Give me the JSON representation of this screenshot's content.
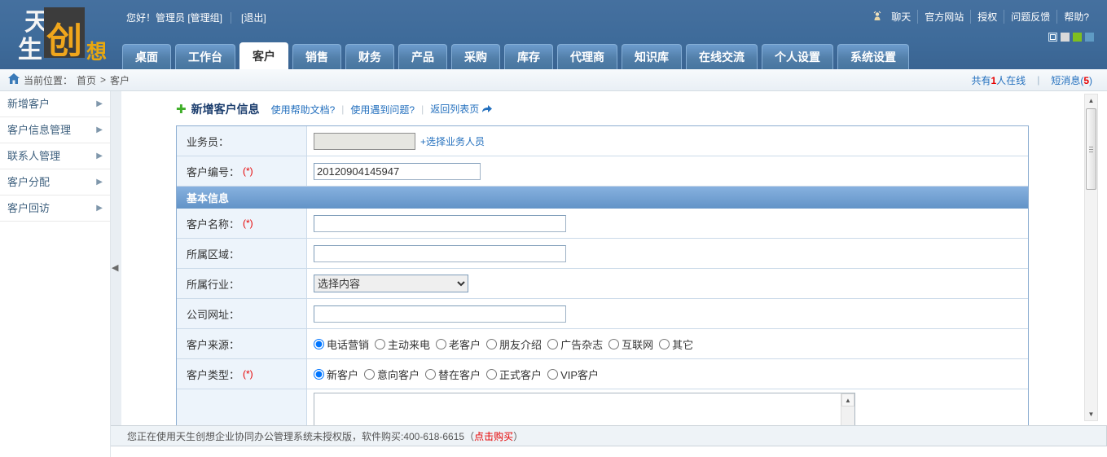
{
  "header": {
    "logo": {
      "char1": "天",
      "char2": "生",
      "char3": "创",
      "char4": "想"
    },
    "greeting": "您好！管理员 [管理组]",
    "logout": "[退出]",
    "top_links": [
      "聊天",
      "官方网站",
      "授权",
      "问题反馈",
      "帮助?"
    ],
    "theme_swatches": [
      "#4a7bab",
      "#d9d9d9",
      "#7fbf1f",
      "#5f9bc4"
    ],
    "tabs": [
      {
        "label": "桌面",
        "active": false
      },
      {
        "label": "工作台",
        "active": false
      },
      {
        "label": "客户",
        "active": true
      },
      {
        "label": "销售",
        "active": false
      },
      {
        "label": "财务",
        "active": false
      },
      {
        "label": "产品",
        "active": false
      },
      {
        "label": "采购",
        "active": false
      },
      {
        "label": "库存",
        "active": false
      },
      {
        "label": "代理商",
        "active": false
      },
      {
        "label": "知识库",
        "active": false
      },
      {
        "label": "在线交流",
        "active": false
      },
      {
        "label": "个人设置",
        "active": false
      },
      {
        "label": "系统设置",
        "active": false
      }
    ]
  },
  "breadcrumb": {
    "label": "当前位置：",
    "home": "首页",
    "separator": ">",
    "current": "客户"
  },
  "status": {
    "online_prefix": "共有",
    "online_count": "1",
    "online_suffix": "人在线",
    "msg_prefix": "短消息(",
    "msg_count": "5",
    "msg_suffix": ")"
  },
  "sidebar": {
    "items": [
      "新增客户",
      "客户信息管理",
      "联系人管理",
      "客户分配",
      "客户回访"
    ]
  },
  "form": {
    "title": "新增客户信息",
    "help_link": "使用帮助文档?",
    "issue_link": "使用遇到问题?",
    "back_link": "返回列表页",
    "rows": {
      "salesman": {
        "label": "业务员：",
        "picker_link": "+选择业务人员"
      },
      "customer_no": {
        "label": "客户编号：",
        "required": "(*)",
        "value": "20120904145947"
      },
      "section_basic": "基本信息",
      "customer_name": {
        "label": "客户名称：",
        "required": "(*)"
      },
      "region": {
        "label": "所属区域："
      },
      "industry": {
        "label": "所属行业：",
        "selected": "选择内容"
      },
      "website": {
        "label": "公司网址："
      },
      "source": {
        "label": "客户来源：",
        "options": [
          "电话营销",
          "主动来电",
          "老客户",
          "朋友介绍",
          "广告杂志",
          "互联网",
          "其它"
        ],
        "selected": "电话营销"
      },
      "type": {
        "label": "客户类型：",
        "required": "(*)",
        "options": [
          "新客户",
          "意向客户",
          "替在客户",
          "正式客户",
          "VIP客户"
        ],
        "selected": "新客户"
      }
    }
  },
  "footer": {
    "text": "您正在使用天生创想企业协同办公管理系统未授权版，软件购买:400-618-6615（",
    "buy_link": "点击购买",
    "text_end": "）"
  }
}
